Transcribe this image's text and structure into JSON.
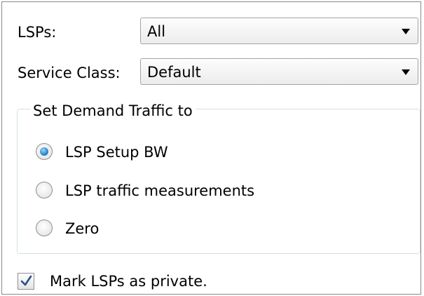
{
  "lsps": {
    "label": "LSPs:",
    "selected": "All"
  },
  "service_class": {
    "label": "Service Class:",
    "selected": "Default"
  },
  "demand_traffic": {
    "title": "Set Demand Traffic to",
    "options": [
      {
        "label": "LSP Setup BW",
        "checked": true
      },
      {
        "label": "LSP traffic measurements",
        "checked": false
      },
      {
        "label": "Zero",
        "checked": false
      }
    ]
  },
  "mark_private": {
    "label": "Mark LSPs as private.",
    "checked": true
  },
  "colors": {
    "radio_selected": "#2f8fd0",
    "checkmark": "#2a4f8a",
    "group_border": "#d5dfe5"
  }
}
